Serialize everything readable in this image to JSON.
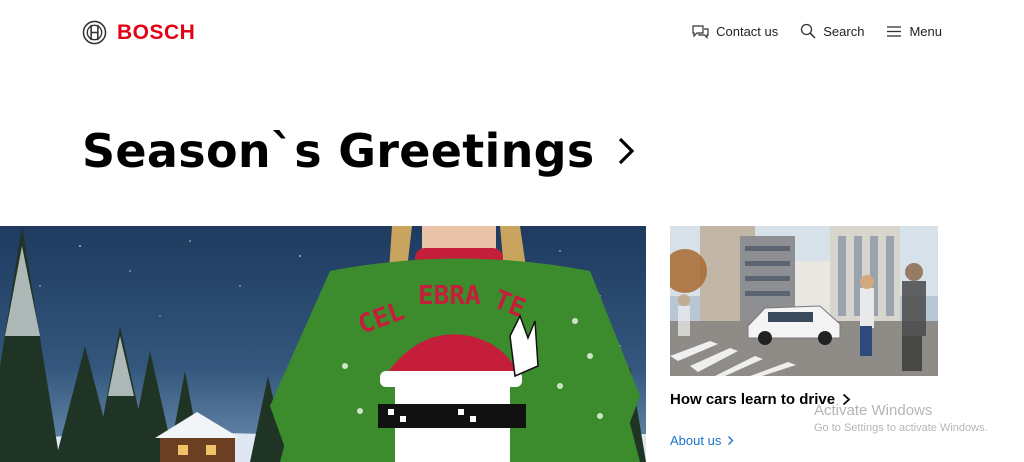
{
  "header": {
    "brand": "BOSCH",
    "nav": {
      "contact_label": "Contact us",
      "search_label": "Search",
      "menu_label": "Menu"
    }
  },
  "main": {
    "title": "Season`s Greetings",
    "hero_image": "christmas-sweater-celebrate",
    "teaser": {
      "image": "city-street-self-driving-car",
      "title": "How cars learn to drive",
      "link_label": "About us"
    }
  },
  "watermark": {
    "title": "Activate Windows",
    "subtitle": "Go to Settings to activate Windows."
  },
  "colors": {
    "brand_red": "#e20015",
    "link_blue": "#1a73c8"
  }
}
